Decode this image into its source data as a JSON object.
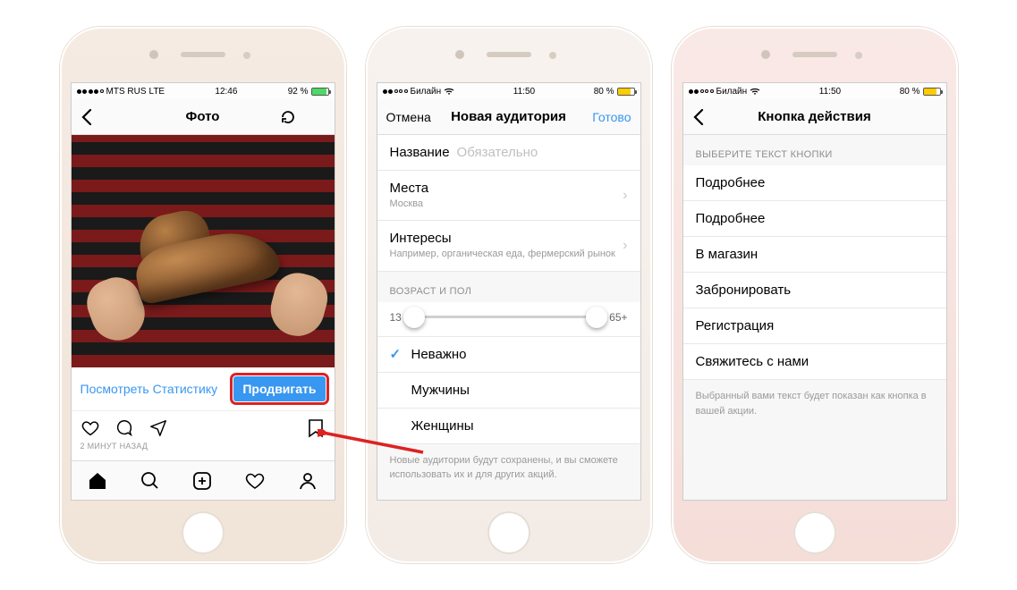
{
  "phone1": {
    "status": {
      "carrier": "MTS RUS",
      "net": "LTE",
      "time": "12:46",
      "battery_pct": "92 %"
    },
    "nav": {
      "title": "Фото"
    },
    "promo": {
      "stats": "Посмотреть Статистику",
      "button": "Продвигать"
    },
    "timestamp": "2 МИНУТ НАЗАД"
  },
  "phone2": {
    "status": {
      "carrier": "Билайн",
      "time": "11:50",
      "battery_pct": "80 %"
    },
    "nav": {
      "left": "Отмена",
      "title": "Новая аудитория",
      "right": "Готово"
    },
    "rows": {
      "name_label": "Название",
      "name_placeholder": "Обязательно",
      "places_label": "Места",
      "places_sub": "Москва",
      "interests_label": "Интересы",
      "interests_sub": "Например, органическая еда, фермерский рынок"
    },
    "age_header": "ВОЗРАСТ И ПОЛ",
    "age_min": "13",
    "age_max": "65+",
    "gender": {
      "any": "Неважно",
      "male": "Мужчины",
      "female": "Женщины"
    },
    "footer": "Новые аудитории будут сохранены, и вы сможете использовать их и для других акций."
  },
  "phone3": {
    "status": {
      "carrier": "Билайн",
      "time": "11:50",
      "battery_pct": "80 %"
    },
    "nav": {
      "title": "Кнопка действия"
    },
    "section": "ВЫБЕРИТЕ ТЕКСТ КНОПКИ",
    "options": [
      "Подробнее",
      "Подробнее",
      "В магазин",
      "Забронировать",
      "Регистрация",
      "Свяжитесь с нами"
    ],
    "footer": "Выбранный вами текст будет показан как кнопка в вашей акции."
  }
}
